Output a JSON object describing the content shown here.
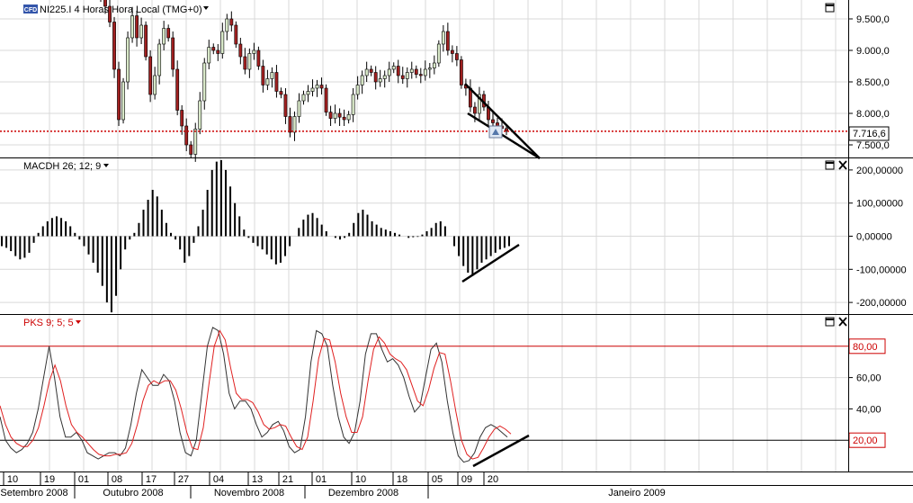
{
  "colors": {
    "grid": "#d9d9d9",
    "candle_up": "#d8e8c8",
    "candle_down": "#a02020",
    "price_line": "#cc0000",
    "stoch_k": "#333333",
    "stoch_d": "#e02020",
    "level_line": "#cc0000",
    "axis_text": "#000000",
    "red_text": "#cc0000"
  },
  "chart_data": [
    {
      "type": "candlestick",
      "title": "NI225.I 4 Horas Hora Local (TMG+0)",
      "badge": "CFD",
      "ylim": [
        7300,
        9800
      ],
      "yticks": [
        "9.500,0",
        "9.000,0",
        "8.500,0",
        "8.000,0",
        "7.500,0"
      ],
      "ytick_values": [
        9500,
        9000,
        8500,
        8000,
        7500
      ],
      "current_price": 7716.6,
      "current_price_label": "7.716,6",
      "closes": [
        9830,
        9700,
        9450,
        8700,
        7900,
        8500,
        9200,
        9550,
        9200,
        9400,
        8900,
        8300,
        8600,
        9100,
        9350,
        9200,
        8700,
        8050,
        7800,
        7500,
        7350,
        7750,
        8200,
        8800,
        9050,
        9000,
        8950,
        9300,
        9500,
        9400,
        9100,
        8900,
        8700,
        8950,
        9000,
        8750,
        8450,
        8550,
        8650,
        8350,
        8300,
        7950,
        7700,
        7950,
        8200,
        8300,
        8350,
        8400,
        8450,
        8400,
        8020,
        7920,
        8000,
        7940,
        7900,
        7980,
        8300,
        8450,
        8600,
        8700,
        8650,
        8500,
        8550,
        8600,
        8700,
        8750,
        8600,
        8550,
        8650,
        8700,
        8620,
        8600,
        8700,
        8720,
        8800,
        9100,
        9300,
        9000,
        8950,
        8850,
        8450,
        8400,
        8100,
        8000,
        8300,
        8100,
        7900,
        7850,
        7800,
        7760,
        7716
      ],
      "x_last_index": 90,
      "x_total_slots": 230
    },
    {
      "type": "histogram",
      "title": "MACDH 26; 12; 9",
      "ylim": [
        -235,
        235
      ],
      "yticks": [
        "200,00000",
        "100,00000",
        "0,00000",
        "-100,00000",
        "-200,00000"
      ],
      "ytick_values": [
        200,
        100,
        0,
        -100,
        -200
      ],
      "values": [
        -30,
        -35,
        -45,
        -60,
        -70,
        -65,
        -50,
        -20,
        10,
        30,
        45,
        55,
        60,
        55,
        45,
        30,
        10,
        -10,
        -30,
        -55,
        -80,
        -110,
        -150,
        -200,
        -230,
        -180,
        -100,
        -40,
        -10,
        10,
        40,
        80,
        110,
        140,
        120,
        80,
        40,
        10,
        -10,
        -40,
        -80,
        -60,
        -20,
        30,
        80,
        140,
        200,
        225,
        230,
        200,
        150,
        100,
        60,
        20,
        -5,
        -20,
        -30,
        -40,
        -55,
        -70,
        -85,
        -80,
        -60,
        -30,
        0,
        25,
        50,
        65,
        70,
        55,
        35,
        15,
        0,
        -5,
        -10,
        -5,
        10,
        40,
        70,
        80,
        65,
        45,
        35,
        25,
        20,
        15,
        10,
        5,
        0,
        -5,
        -3,
        -2,
        5,
        15,
        25,
        40,
        45,
        30,
        0,
        -30,
        -60,
        -90,
        -110,
        -120,
        -100,
        -80,
        -70,
        -60,
        -50,
        -40,
        -35,
        -30
      ],
      "x_total_slots": 230
    },
    {
      "type": "line",
      "title": "PKS 9; 5; 5",
      "ylim": [
        0,
        100
      ],
      "yticks": [
        "60,00",
        "40,00"
      ],
      "ytick_values": [
        60,
        40
      ],
      "levels": [
        {
          "value": 80,
          "label": "80,00"
        },
        {
          "value": 20,
          "label": "20,00"
        }
      ],
      "series": [
        {
          "values": [
            35,
            20,
            15,
            12,
            14,
            18,
            25,
            40,
            60,
            80,
            60,
            35,
            22,
            22,
            25,
            20,
            12,
            10,
            8,
            10,
            12,
            12,
            10,
            15,
            30,
            50,
            65,
            60,
            55,
            55,
            62,
            58,
            45,
            25,
            12,
            10,
            20,
            50,
            80,
            92,
            90,
            75,
            50,
            40,
            45,
            45,
            40,
            30,
            22,
            25,
            30,
            32,
            26,
            16,
            12,
            14,
            35,
            70,
            90,
            88,
            80,
            55,
            35,
            22,
            18,
            25,
            45,
            75,
            88,
            88,
            78,
            70,
            72,
            68,
            60,
            48,
            38,
            42,
            60,
            78,
            82,
            70,
            45,
            25,
            10,
            6,
            7,
            12,
            22,
            28,
            30,
            28,
            25,
            22
          ]
        },
        {
          "values": [
            42,
            30,
            22,
            18,
            16,
            16,
            20,
            28,
            42,
            58,
            68,
            58,
            42,
            30,
            25,
            22,
            18,
            14,
            11,
            10,
            10,
            11,
            11,
            12,
            18,
            30,
            45,
            55,
            58,
            56,
            58,
            58,
            52,
            40,
            25,
            15,
            14,
            28,
            55,
            80,
            90,
            84,
            66,
            50,
            46,
            46,
            44,
            38,
            30,
            27,
            28,
            30,
            29,
            22,
            16,
            14,
            22,
            45,
            72,
            85,
            84,
            70,
            50,
            35,
            25,
            25,
            35,
            58,
            78,
            86,
            82,
            75,
            72,
            70,
            65,
            55,
            45,
            42,
            52,
            66,
            76,
            75,
            58,
            38,
            20,
            11,
            8,
            9,
            15,
            22,
            27,
            29,
            27,
            24
          ]
        }
      ],
      "x_total_slots": 230
    }
  ],
  "x_axis": {
    "day_labels": [
      "10",
      "19",
      "01",
      "08",
      "17",
      "27",
      "04",
      "13",
      "21",
      "01",
      "10",
      "18",
      "05",
      "09",
      "20"
    ],
    "month_labels": [
      "Setembro 2008",
      "Outubro 2008",
      "Novembro 2008",
      "Dezembro 2008",
      "Janeiro 2009"
    ]
  },
  "icons": {
    "title_dropdown": "caret-down-icon",
    "panel_maximize": "maximize-icon",
    "panel_close": "close-icon",
    "alert": "alert-triangle-icon"
  }
}
